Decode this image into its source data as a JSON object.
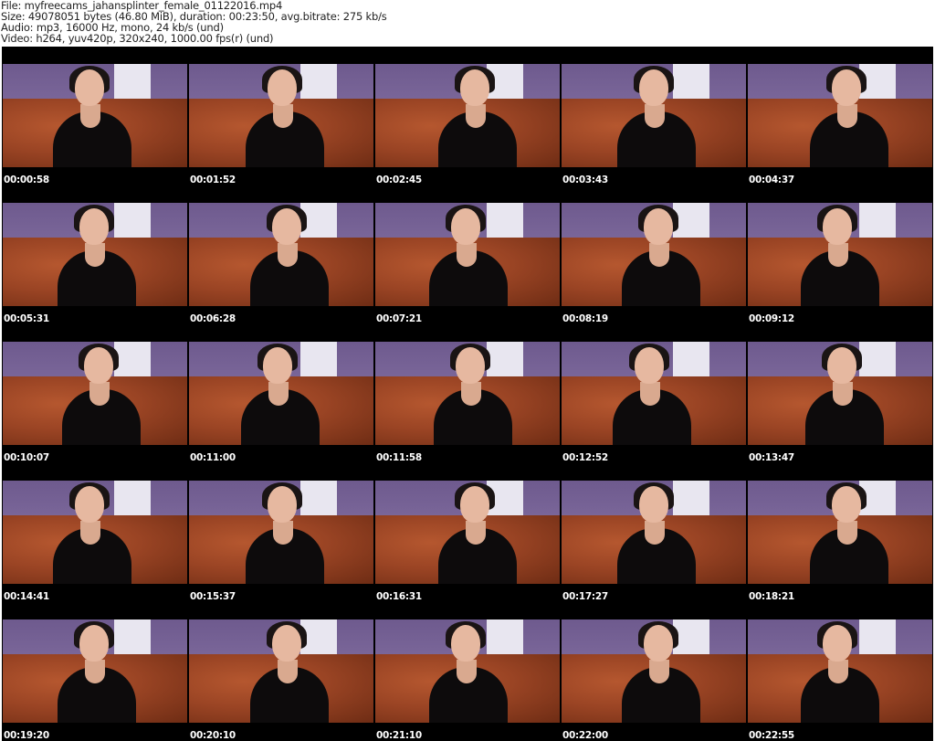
{
  "header": {
    "file": "File: myfreecams_jahansplinter_female_01122016.mp4",
    "size": "Size: 49078051 bytes (46.80 MiB), duration: 00:23:50, avg.bitrate: 275 kb/s",
    "audio": "Audio: mp3, 16000 Hz, mono, 24 kb/s (und)",
    "video": "Video: h264, yuv420p, 320x240, 1000.00 fps(r) (und)"
  },
  "thumbnails": [
    "00:00:58",
    "00:01:52",
    "00:02:45",
    "00:03:43",
    "00:04:37",
    "00:05:31",
    "00:06:28",
    "00:07:21",
    "00:08:19",
    "00:09:12",
    "00:10:07",
    "00:11:00",
    "00:11:58",
    "00:12:52",
    "00:13:47",
    "00:14:41",
    "00:15:37",
    "00:16:31",
    "00:17:27",
    "00:18:21",
    "00:19:20",
    "00:20:10",
    "00:21:10",
    "00:22:00",
    "00:22:55"
  ]
}
